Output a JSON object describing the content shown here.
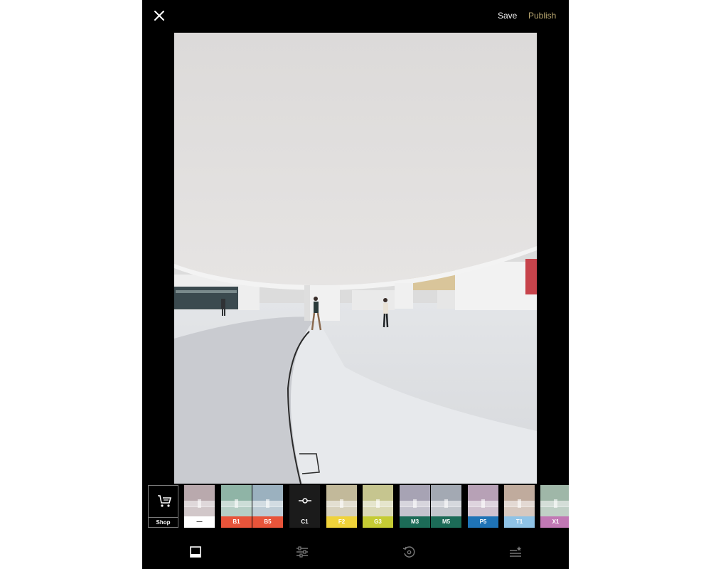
{
  "topbar": {
    "save_label": "Save",
    "publish_label": "Publish"
  },
  "filters": [
    {
      "label": "Shop",
      "kind": "shop"
    },
    {
      "label": "—",
      "label_bg": "#ffffff",
      "label_color": "#222222",
      "tint": "#b9a9ad"
    },
    {
      "label": "B1",
      "label_bg": "#e8543a",
      "label_color": "#ffffff",
      "tint": "#8fb4a6"
    },
    {
      "label": "B5",
      "label_bg": "#e8543a",
      "label_color": "#ffffff",
      "tint": "#9bb1bf"
    },
    {
      "label": "C1",
      "kind": "selected",
      "label_bg": "#1b1b1b",
      "label_color": "#ffffff"
    },
    {
      "label": "F2",
      "label_bg": "#f0d33a",
      "label_color": "#ffffff",
      "tint": "#c2b99a"
    },
    {
      "label": "G3",
      "label_bg": "#c5cc34",
      "label_color": "#ffffff",
      "tint": "#c6c58f"
    },
    {
      "label": "M3",
      "label_bg": "#1c6b57",
      "label_color": "#ffffff",
      "tint": "#a7a3b4"
    },
    {
      "label": "M5",
      "label_bg": "#1c6b57",
      "label_color": "#ffffff",
      "tint": "#a3a9b3"
    },
    {
      "label": "P5",
      "label_bg": "#1f73b6",
      "label_color": "#ffffff",
      "tint": "#b7a1b6"
    },
    {
      "label": "T1",
      "label_bg": "#8fc3e6",
      "label_color": "#ffffff",
      "tint": "#c0ab9d"
    },
    {
      "label": "X1",
      "label_bg": "#c178b4",
      "label_color": "#ffffff",
      "tint": "#9fb7a8"
    }
  ],
  "bottom_nav": [
    {
      "name": "presets-nav-icon",
      "active": true
    },
    {
      "name": "adjust-nav-icon",
      "active": false
    },
    {
      "name": "history-nav-icon",
      "active": false
    },
    {
      "name": "recipes-nav-icon",
      "active": false
    }
  ],
  "colors": {
    "background": "#000000",
    "publish_accent": "#b7a56f",
    "save_text": "#f2f2f2"
  }
}
